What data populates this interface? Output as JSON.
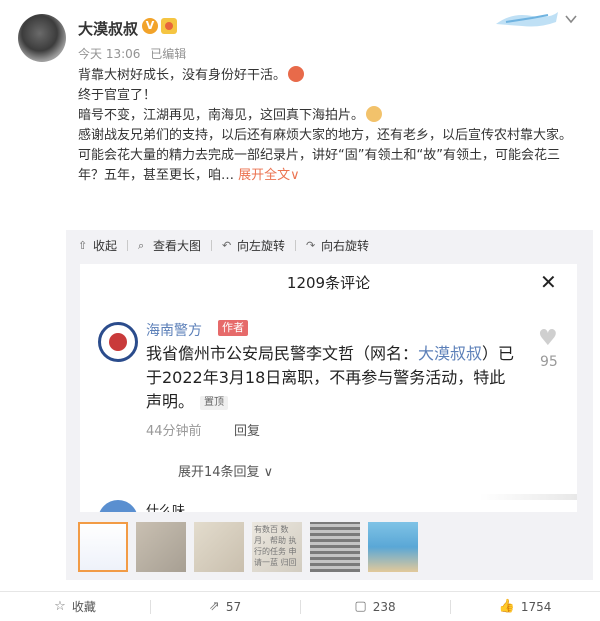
{
  "post": {
    "username": "大漠叔叔",
    "verified_badge": "V",
    "timestamp": "今天 13:06",
    "edited_label": "已编辑",
    "lines": [
      "背靠大树好成长，没有身份好干活。",
      "终于官宣了！",
      "暗号不变，江湖再见，南海见，这回真下海拍片。",
      "感谢战友兄弟们的支持，以后还有麻烦大家的地方，还有老乡，以后宣传农村靠大家。",
      "可能会花大量的精力去完成一部纪录片，讲好“固”有领土和“故”有领土，可能会花三年？五年，甚至更长，咱…"
    ],
    "expand_label": "展开全文",
    "expand_chevron": "∨"
  },
  "gallery": {
    "tools": {
      "collapse": "收起",
      "view_large": "查看大图",
      "rotate_left": "向左旋转",
      "rotate_right": "向右旋转"
    },
    "screenshot": {
      "title": "1209条评论",
      "close_symbol": "✕",
      "commenter": "海南警方",
      "author_tag": "作者",
      "comment_prefix": "我省儋州市公安局民警李文哲（网名：",
      "comment_link": "大漠叔叔",
      "comment_suffix": "）已于2022年3月18日离职，不再参与警务活动，特此声明。",
      "pinned_tag": "置顶",
      "comment_time": "44分钟前",
      "reply_label": "回复",
      "like_count": "95",
      "expand_replies": "展开14条回复",
      "next_comment": "什么味"
    },
    "thumbnail_4_text": "有数百 数月，帮助 执行的任务 申请一蓝 归回"
  },
  "footer": {
    "favorite": "收藏",
    "repost_count": "57",
    "comment_count": "238",
    "like_count": "1754"
  },
  "icons": {
    "chevron": "chevron-down-icon",
    "favorite": "star-icon",
    "repost": "repost-icon",
    "comment": "comment-icon",
    "like": "thumbs-up-icon"
  },
  "colors": {
    "accent": "#eb7350",
    "link": "#5b7fb8",
    "author_tag": "#e66a6a",
    "thumb_border": "#f29b45"
  }
}
